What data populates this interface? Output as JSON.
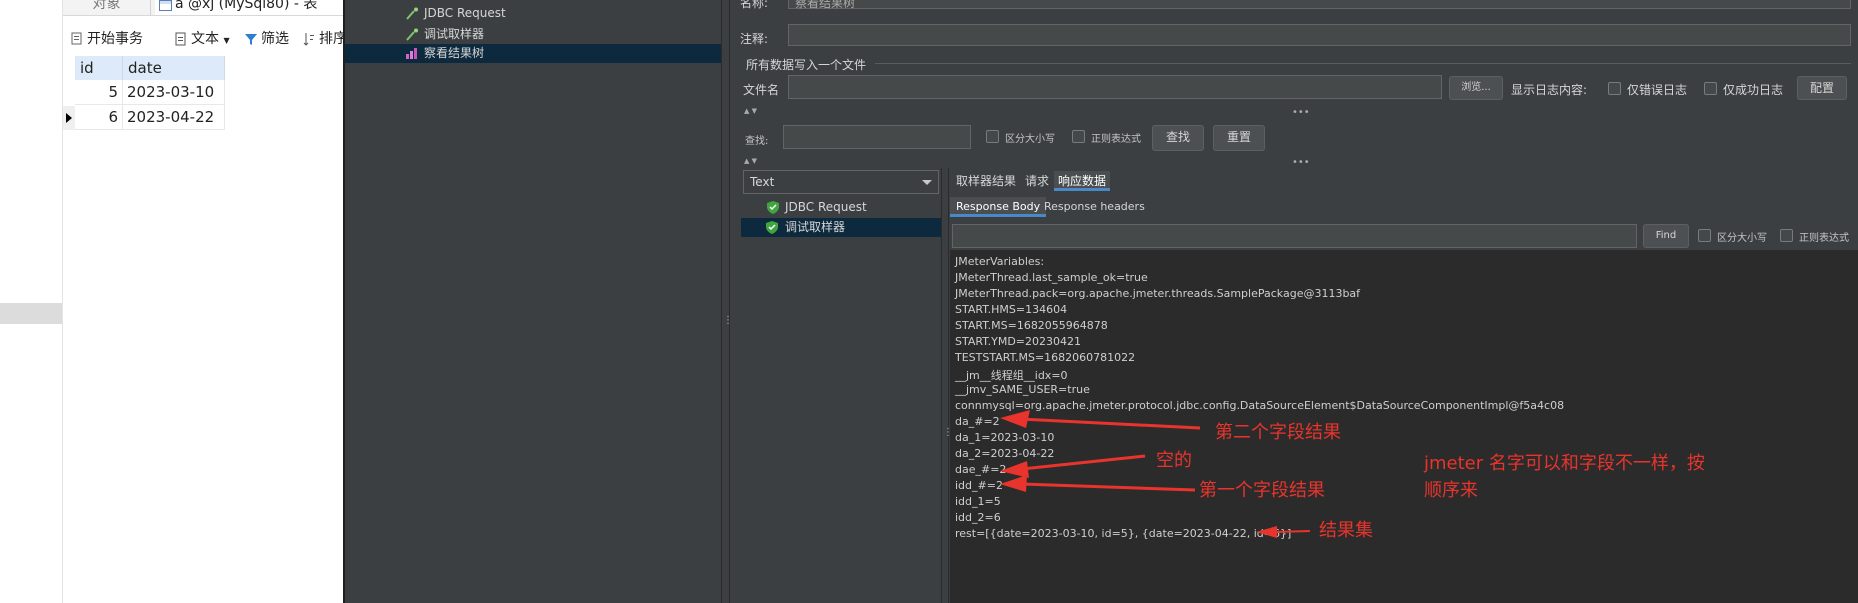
{
  "navicat": {
    "tab_objects": "对象",
    "tab_table": "a @xj (MySql80) - 表",
    "toolbar": {
      "begin_transaction": "开始事务",
      "text": "文本",
      "filter": "筛选",
      "sort": "排序"
    },
    "columns": [
      "id",
      "date"
    ],
    "rows": [
      {
        "id": "5",
        "date": "2023-03-10"
      },
      {
        "id": "6",
        "date": "2023-04-22"
      }
    ]
  },
  "jmeter": {
    "tree": [
      "JDBC Request",
      "调试取样器",
      "察看结果树"
    ],
    "name_label": "名称:",
    "name_value": "察看结果树",
    "comment_label": "注释:",
    "write_all_label": "所有数据写入一个文件",
    "filename_label": "文件名",
    "browse_button": "浏览...",
    "log_content_label": "显示日志内容:",
    "errors_only": "仅错误日志",
    "success_only": "仅成功日志",
    "configure_button": "配置",
    "search_label": "查找:",
    "case_sensitive": "区分大小写",
    "regex": "正则表达式",
    "find_button": "查找",
    "reset_button": "重置",
    "renderer": "Text",
    "results": [
      "JDBC Request",
      "调试取样器"
    ],
    "tabs": [
      "取样器结果",
      "请求",
      "响应数据"
    ],
    "subtabs": [
      "Response Body",
      "Response headers"
    ],
    "find_small_button": "Find",
    "case_sensitive_small": "区分大小写",
    "regex_small": "正则表达式",
    "response_lines": [
      "JMeterVariables:",
      "JMeterThread.last_sample_ok=true",
      "JMeterThread.pack=org.apache.jmeter.threads.SamplePackage@3113baf",
      "START.HMS=134604",
      "START.MS=1682055964878",
      "START.YMD=20230421",
      "TESTSTART.MS=1682060781022",
      "__jm__线程组__idx=0",
      "__jmv_SAME_USER=true",
      "connmysql=org.apache.jmeter.protocol.jdbc.config.DataSourceElement$DataSourceComponentImpl@f5a4c08",
      "da_#=2",
      "da_1=2023-03-10",
      "da_2=2023-04-22",
      "dae_#=2",
      "idd_#=2",
      "idd_1=5",
      "idd_2=6",
      "rest=[{date=2023-03-10, id=5}, {date=2023-04-22, id=6}]"
    ]
  },
  "annotations": {
    "second_field": "第二个字段结果",
    "empty": "空的",
    "first_field": "第一个字段结果",
    "note_line1": "jmeter 名字可以和字段不一样，按",
    "note_line2": "顺序来",
    "result_set": "结果集"
  },
  "colors": {
    "jmeter_bg": "#3c3f41",
    "annotation_red": "#e8342c",
    "selection": "#0d293e",
    "tab_accent": "#4a88c7"
  }
}
